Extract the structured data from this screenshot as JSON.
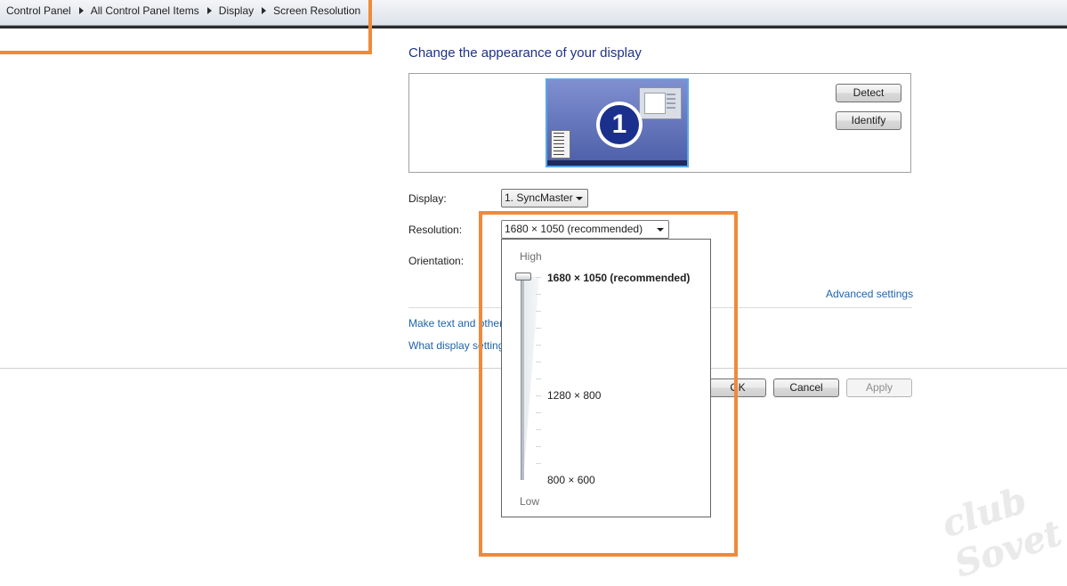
{
  "breadcrumb": [
    "Control Panel",
    "All Control Panel Items",
    "Display",
    "Screen Resolution"
  ],
  "page": {
    "heading": "Change the appearance of your display"
  },
  "preview": {
    "monitor_number": "1",
    "detect_label": "Detect",
    "identify_label": "Identify"
  },
  "settings": {
    "display_label": "Display:",
    "display_value": "1. SyncMaster",
    "resolution_label": "Resolution:",
    "resolution_value": "1680 × 1050 (recommended)",
    "orientation_label": "Orientation:"
  },
  "resolution_popup": {
    "high_label": "High",
    "low_label": "Low",
    "options": [
      "1680 × 1050 (recommended)",
      "1280 × 800",
      "800 × 600"
    ],
    "selected": "1680 × 1050 (recommended)"
  },
  "links": {
    "advanced": "Advanced settings",
    "text_size": "Make text and other",
    "what_settings": "What display setting"
  },
  "footer": {
    "ok_label": "OK",
    "cancel_label": "Cancel",
    "apply_label": "Apply"
  },
  "watermark": "club Sovet",
  "colors": {
    "annotation": "#ef8a3a",
    "link": "#1e64aa",
    "heading": "#1e3287"
  }
}
